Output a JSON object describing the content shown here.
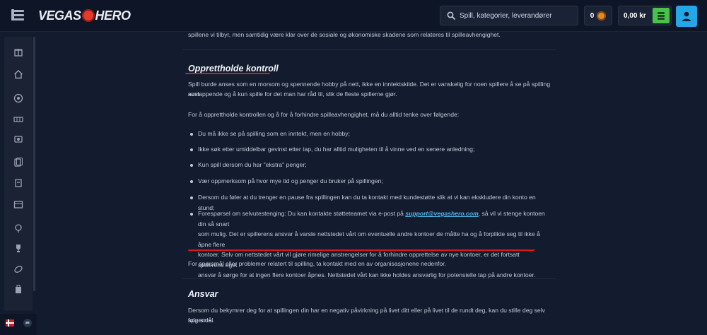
{
  "header": {
    "logo_left": "VEGAS",
    "logo_right": "HERO",
    "search_placeholder": "Spill, kategorier, leverandører",
    "coins_count": "0",
    "balance": "0,00 kr"
  },
  "sidebar": {
    "items": [
      {
        "icon": "gift-icon"
      },
      {
        "icon": "home-icon"
      },
      {
        "icon": "roulette-icon"
      },
      {
        "icon": "slot-icon"
      },
      {
        "icon": "live-casino-icon"
      },
      {
        "icon": "cards-icon"
      },
      {
        "icon": "jackpot-icon"
      },
      {
        "icon": "calendar-icon"
      },
      {
        "icon": "trophy-badge-icon"
      },
      {
        "icon": "trophy-icon"
      },
      {
        "icon": "sports-icon"
      },
      {
        "icon": "shop-icon"
      }
    ]
  },
  "content": {
    "intro_tail": "spillene vi tilbyr, men samtidig være klar over de sosiale og økonomiske skadene som relateres til spilleavhengighet.",
    "section1": {
      "title": "Opprettholde kontroll",
      "para1_line1": "Spill burde anses som en morsom og spennende hobby på nett, ikke en inntektskilde. Det er vanskelig for noen spillere å se på spilling som",
      "para1_line2": "avslappende og å kun spille for det man har råd til, slik de fleste spillerne gjør.",
      "para2": "For å opprettholde kontrollen og å for å forhindre spilleavhengighet, må du alltid tenke over følgende:",
      "bullets": [
        "Du må ikke se på spilling som en inntekt, men en hobby;",
        "Ikke søk etter umiddelbar gevinst etter tap, du har alltid muligheten til å vinne ved en senere anledning;",
        "Kun spill dersom du har \"ekstra\" penger;",
        "Vær oppmerksom på hvor mye tid og penger du bruker på spillingen;",
        "Dersom du føler at du trenger en pause fra spillingen kan du ta kontakt med kundestøtte slik at vi kan ekskludere din konto en stund;"
      ],
      "last_bullet": {
        "prefix": "Forespørsel om selvutestenging: Du kan kontakte støtteteamet via e-post på ",
        "email": "support@vegashero.com",
        "after_email": ", så vil vi stenge kontoen din så snart",
        "line2": "som mulig. Det er spillerens ansvar å varsle nettstedet vårt om eventuelle andre kontoer de måtte ha og å forplikte seg til ikke å åpne flere",
        "line3": "kontoer. Selv om nettstedet vårt vil gjøre rimelige anstrengelser for å forhindre opprettelse av nye kontoer, er det fortsatt spillerens eget",
        "line4": "ansvar å sørge for at ingen flere kontoer åpnes. Nettstedet vårt kan ikke holdes ansvarlig for potensielle tap på andre kontoer."
      },
      "para3": "For spørsmål eller problemer relatert til spilling, ta kontakt med en av organisasjonene nedenfor."
    },
    "section2": {
      "title": "Ansvar",
      "para_line1": "Dersom du bekymrer deg for at spillingen din har en negativ påvirkning på livet ditt eller på livet til de rundt deg, kan du stille deg selv følgende",
      "para_line2": "spørsmål."
    }
  },
  "colors": {
    "accent_red": "#e0161e",
    "link_blue": "#4fb8ee",
    "wallet_green": "#49c24a",
    "account_blue": "#23a7e6"
  }
}
